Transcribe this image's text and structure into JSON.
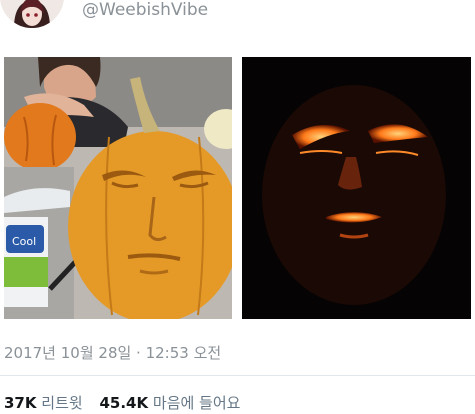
{
  "tweet": {
    "handle": "@WeebishVibe",
    "timestamp": "2017년 10월 28일 · 12:53 오전",
    "stats": {
      "retweets_count": "37K",
      "retweets_label": "리트윗",
      "likes_count": "45.4K",
      "likes_label": "마음에 들어요"
    }
  },
  "photos": [
    {
      "name": "pumpkin-daylight-photo"
    },
    {
      "name": "pumpkin-lit-dark-photo"
    }
  ]
}
